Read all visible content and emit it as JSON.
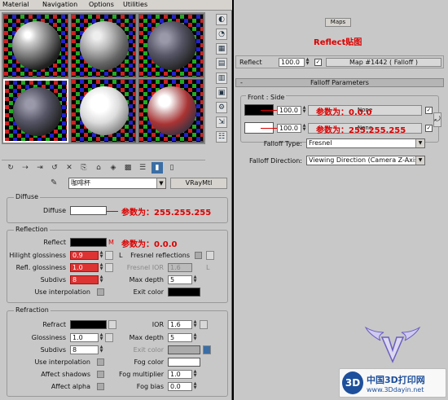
{
  "left": {
    "menu": [
      "Material",
      "Navigation",
      "Options",
      "Utilities"
    ],
    "material_name": "咖啡杯",
    "material_type": "VRayMtl",
    "diffuse": {
      "group_title": "Diffuse",
      "label": "Diffuse",
      "annotation": "参数为：255.255.255"
    },
    "reflection": {
      "group_title": "Reflection",
      "reflect_label": "Reflect",
      "reflect_map_letter": "M",
      "annotation": "参数为：0.0.0",
      "hilight_label": "Hilight glossiness",
      "hilight_value": "0.9",
      "lock_letter": "L",
      "fresnel_label": "Fresnel reflections",
      "refl_gloss_label": "Refl. glossiness",
      "refl_gloss_value": "1.0",
      "fresnel_ior_label": "Fresnel IOR",
      "fresnel_ior_value": "1.6",
      "fresnel_ior_lock": "L",
      "subdivs_label": "Subdivs",
      "subdivs_value": "8",
      "max_depth_label": "Max depth",
      "max_depth_value": "5",
      "use_interp_label": "Use interpolation",
      "exit_color_label": "Exit color"
    },
    "refraction": {
      "group_title": "Refraction",
      "refract_label": "Refract",
      "ior_label": "IOR",
      "ior_value": "1.6",
      "glossiness_label": "Glossiness",
      "glossiness_value": "1.0",
      "max_depth_label": "Max depth",
      "max_depth_value": "5",
      "subdivs_label": "Subdivs",
      "subdivs_value": "8",
      "exit_color_label": "Exit color",
      "use_interp_label": "Use interpolation",
      "fog_color_label": "Fog color",
      "affect_shadows_label": "Affect shadows",
      "fog_mult_label": "Fog multiplier",
      "fog_mult_value": "1.0",
      "affect_alpha_label": "Affect alpha",
      "fog_bias_label": "Fog bias",
      "fog_bias_value": "0.0"
    }
  },
  "right": {
    "maps_button": "Maps",
    "title_annotation": "Reflect贴图",
    "reflect_label": "Reflect",
    "reflect_value": "100.0",
    "reflect_map": "Map #1442  ( Falloff )",
    "panel_header_sign": "-",
    "panel_header": "Falloff Parameters",
    "front_side_label": "Front : Side",
    "front_value": "100.0",
    "side_value": "100.0",
    "none_label": "None",
    "front_annotation": "参数为：0.0.0",
    "side_annotation": "参数为：255.255.255",
    "falloff_type_label": "Falloff Type:",
    "falloff_type_value": "Fresnel",
    "falloff_direction_label": "Falloff Direction:",
    "falloff_direction_value": "Viewing Direction (Camera Z-Axis)"
  },
  "logo": {
    "badge": "3D",
    "chinese": "中国3D打印网",
    "url": "www.3Ddayin.net"
  },
  "colors": {
    "annotation_red": "#dd0000",
    "highlight_red": "#d33333",
    "logo_blue": "#1d4f9c"
  }
}
